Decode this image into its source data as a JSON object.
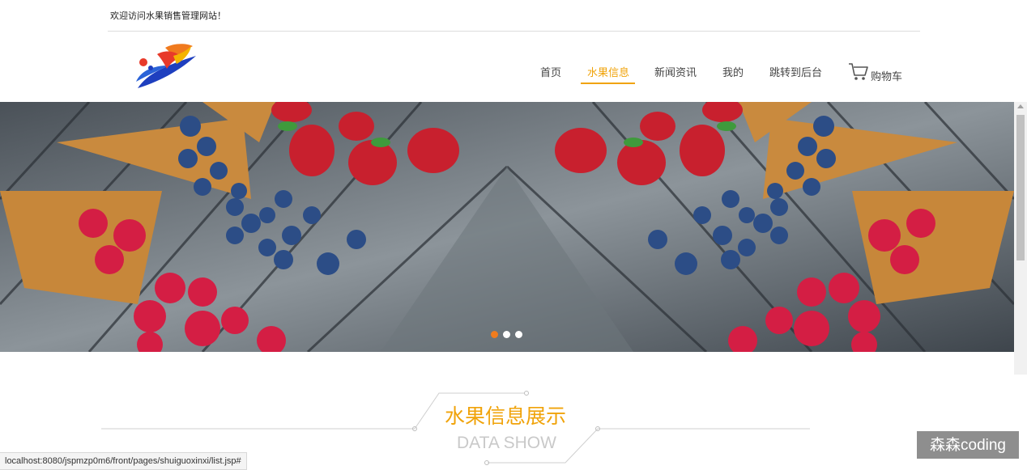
{
  "topbar": {
    "welcome": "欢迎访问水果销售管理网站！"
  },
  "nav": {
    "items": [
      {
        "label": "首页"
      },
      {
        "label": "水果信息"
      },
      {
        "label": "新闻资讯"
      },
      {
        "label": "我的"
      },
      {
        "label": "跳转到后台"
      }
    ],
    "active_index": 1,
    "cart_label": "购物车"
  },
  "banner": {
    "slide_count": 3,
    "active_slide": 0
  },
  "section": {
    "title": "水果信息展示",
    "subtitle": "DATA SHOW"
  },
  "statusbar": {
    "url": "localhost:8080/jspmzp0m6/front/pages/shuiguoxinxi/list.jsp#"
  },
  "watermark": {
    "text": "森森coding"
  },
  "colors": {
    "accent": "#f0a30a",
    "dot_active": "#f07c1e",
    "divider": "#dcdcdc"
  },
  "icons": {
    "cart": "cart-icon",
    "logo": "logo-icon"
  }
}
